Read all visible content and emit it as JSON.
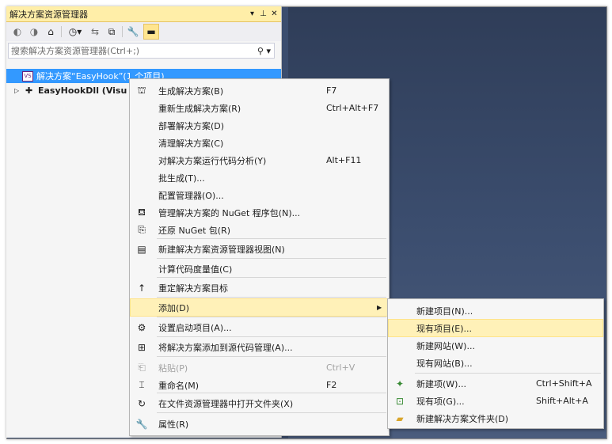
{
  "panel": {
    "title": "解决方案资源管理器",
    "title_icons": [
      "▾",
      "⊥",
      "✕"
    ],
    "search_placeholder": "搜索解决方案资源管理器(Ctrl+;)",
    "search_icon": "⚲ ▾"
  },
  "toolbar_icons": [
    "back-icon",
    "forward-icon",
    "home-icon",
    "history-icon",
    "sync-icon",
    "collapse-icon",
    "properties-icon",
    "pin-icon"
  ],
  "tree": {
    "solution": "解决方案“EasyHook”(1 个项目)",
    "project": "EasyHookDll (Visu"
  },
  "context_menu": {
    "items": [
      {
        "label": "生成解决方案(B)",
        "shortcut": "F7",
        "icon": "⛫"
      },
      {
        "label": "重新生成解决方案(R)",
        "shortcut": "Ctrl+Alt+F7",
        "icon": ""
      },
      {
        "label": "部署解决方案(D)",
        "shortcut": "",
        "icon": ""
      },
      {
        "label": "清理解决方案(C)",
        "shortcut": "",
        "icon": ""
      },
      {
        "label": "对解决方案运行代码分析(Y)",
        "shortcut": "Alt+F11",
        "icon": ""
      },
      {
        "label": "批生成(T)...",
        "shortcut": "",
        "icon": ""
      },
      {
        "label": "配置管理器(O)...",
        "shortcut": "",
        "icon": ""
      },
      {
        "label": "管理解决方案的 NuGet 程序包(N)...",
        "shortcut": "",
        "icon": "⛾"
      },
      {
        "label": "还原 NuGet 包(R)",
        "shortcut": "",
        "icon": "⎘"
      },
      {
        "label": "新建解决方案资源管理器视图(N)",
        "shortcut": "",
        "icon": "▤"
      },
      {
        "label": "计算代码度量值(C)",
        "shortcut": "",
        "icon": ""
      },
      {
        "label": "重定解决方案目标",
        "shortcut": "",
        "icon": "↑"
      },
      {
        "label": "添加(D)",
        "shortcut": "",
        "icon": ""
      },
      {
        "label": "设置启动项目(A)...",
        "shortcut": "",
        "icon": "⚙"
      },
      {
        "label": "将解决方案添加到源代码管理(A)...",
        "shortcut": "",
        "icon": "⊞"
      },
      {
        "label": "粘贴(P)",
        "shortcut": "Ctrl+V",
        "icon": "⎗"
      },
      {
        "label": "重命名(M)",
        "shortcut": "F2",
        "icon": "⌶"
      },
      {
        "label": "在文件资源管理器中打开文件夹(X)",
        "shortcut": "",
        "icon": "↻"
      },
      {
        "label": "属性(R)",
        "shortcut": "",
        "icon": "🔧"
      }
    ]
  },
  "submenu": {
    "items": [
      {
        "label": "新建项目(N)...",
        "shortcut": "",
        "icon": ""
      },
      {
        "label": "现有项目(E)...",
        "shortcut": "",
        "icon": ""
      },
      {
        "label": "新建网站(W)...",
        "shortcut": "",
        "icon": ""
      },
      {
        "label": "现有网站(B)...",
        "shortcut": "",
        "icon": ""
      },
      {
        "label": "新建项(W)...",
        "shortcut": "Ctrl+Shift+A",
        "icon": "✦"
      },
      {
        "label": "现有项(G)...",
        "shortcut": "Shift+Alt+A",
        "icon": "⊡"
      },
      {
        "label": "新建解决方案文件夹(D)",
        "shortcut": "",
        "icon": "▰"
      }
    ]
  },
  "colors": {
    "accent": "#3399ff",
    "highlight": "#fff1b8",
    "background": "#3b4d6e",
    "title_bar": "#ffeea8"
  }
}
